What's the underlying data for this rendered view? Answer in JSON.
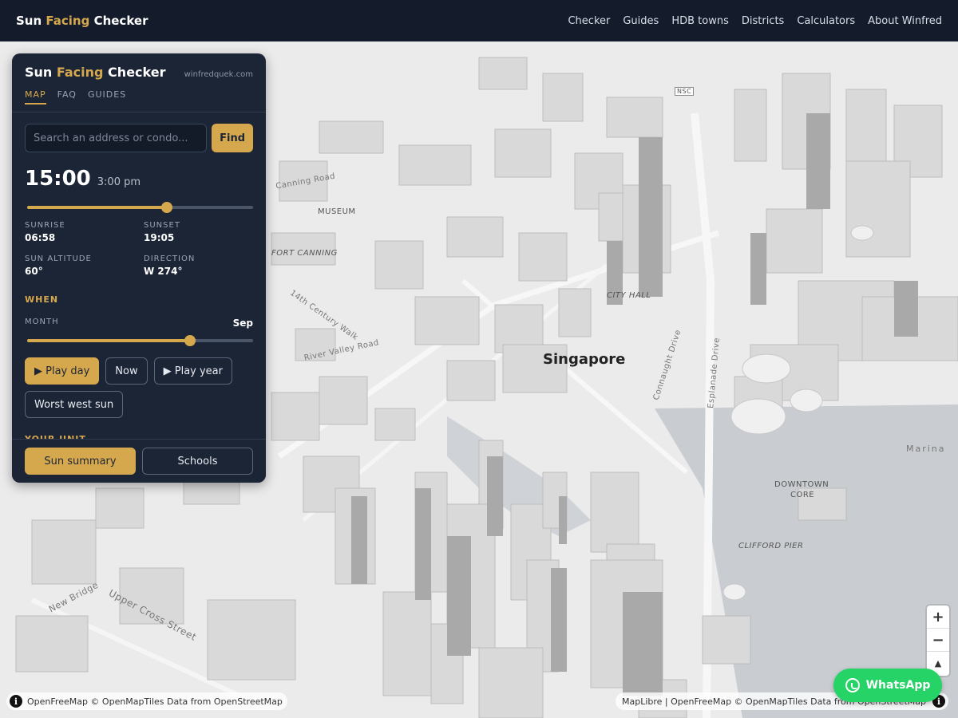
{
  "nav": {
    "brand_pre": "Sun ",
    "brand_accent": "Facing",
    "brand_post": " Checker",
    "links": [
      "Checker",
      "Guides",
      "HDB towns",
      "Districts",
      "Calculators",
      "About Winfred"
    ]
  },
  "panel": {
    "title_pre": "Sun ",
    "title_accent": "Facing",
    "title_post": " Checker",
    "site": "winfredquek.com",
    "tabs": [
      "MAP",
      "FAQ",
      "GUIDES"
    ],
    "search_placeholder": "Search an address or condo...",
    "find_label": "Find",
    "time_big": "15:00",
    "time_small": "3:00 pm",
    "time_fraction": 0.62,
    "sunrise_label": "SUNRISE",
    "sunrise": "06:58",
    "sunset_label": "SUNSET",
    "sunset": "19:05",
    "altitude_label": "SUN ALTITUDE",
    "altitude": "60°",
    "direction_label": "DIRECTION",
    "direction": "W 274°",
    "when_label": "WHEN",
    "month_label": "MONTH",
    "month_value": "Sep",
    "month_fraction": 0.72,
    "play_day": "▶ Play day",
    "now": "Now",
    "play_year": "▶ Play year",
    "worst_west": "Worst west sun",
    "your_unit": "YOUR UNIT",
    "sun_summary": "Sun summary",
    "schools": "Schools"
  },
  "map": {
    "labels": {
      "museum": "MUSEUM",
      "fort_canning": "FORT CANNING",
      "city_hall": "CITY HALL",
      "singapore": "Singapore",
      "downtown_1": "DOWNTOWN",
      "downtown_2": "CORE",
      "clifford_pier": "CLIFFORD PIER",
      "upper_cross": "Upper Cross Street",
      "river_valley": "River Valley Road",
      "connaught": "Connaught Drive",
      "esplanade": "Esplanade Drive",
      "marina": "Marina",
      "nsc": "NSC",
      "canning_road": "Canning Road",
      "century_walk": "14th Century Walk",
      "new_bridge": "New Bridge"
    },
    "zoom_in": "+",
    "zoom_out": "−",
    "compass": "▲",
    "attrib_left": "OpenFreeMap © OpenMapTiles Data from OpenStreetMap",
    "attrib_right": "MapLibre | OpenFreeMap © OpenMapTiles Data from OpenStreetMap",
    "info": "i"
  },
  "whatsapp": "WhatsApp"
}
